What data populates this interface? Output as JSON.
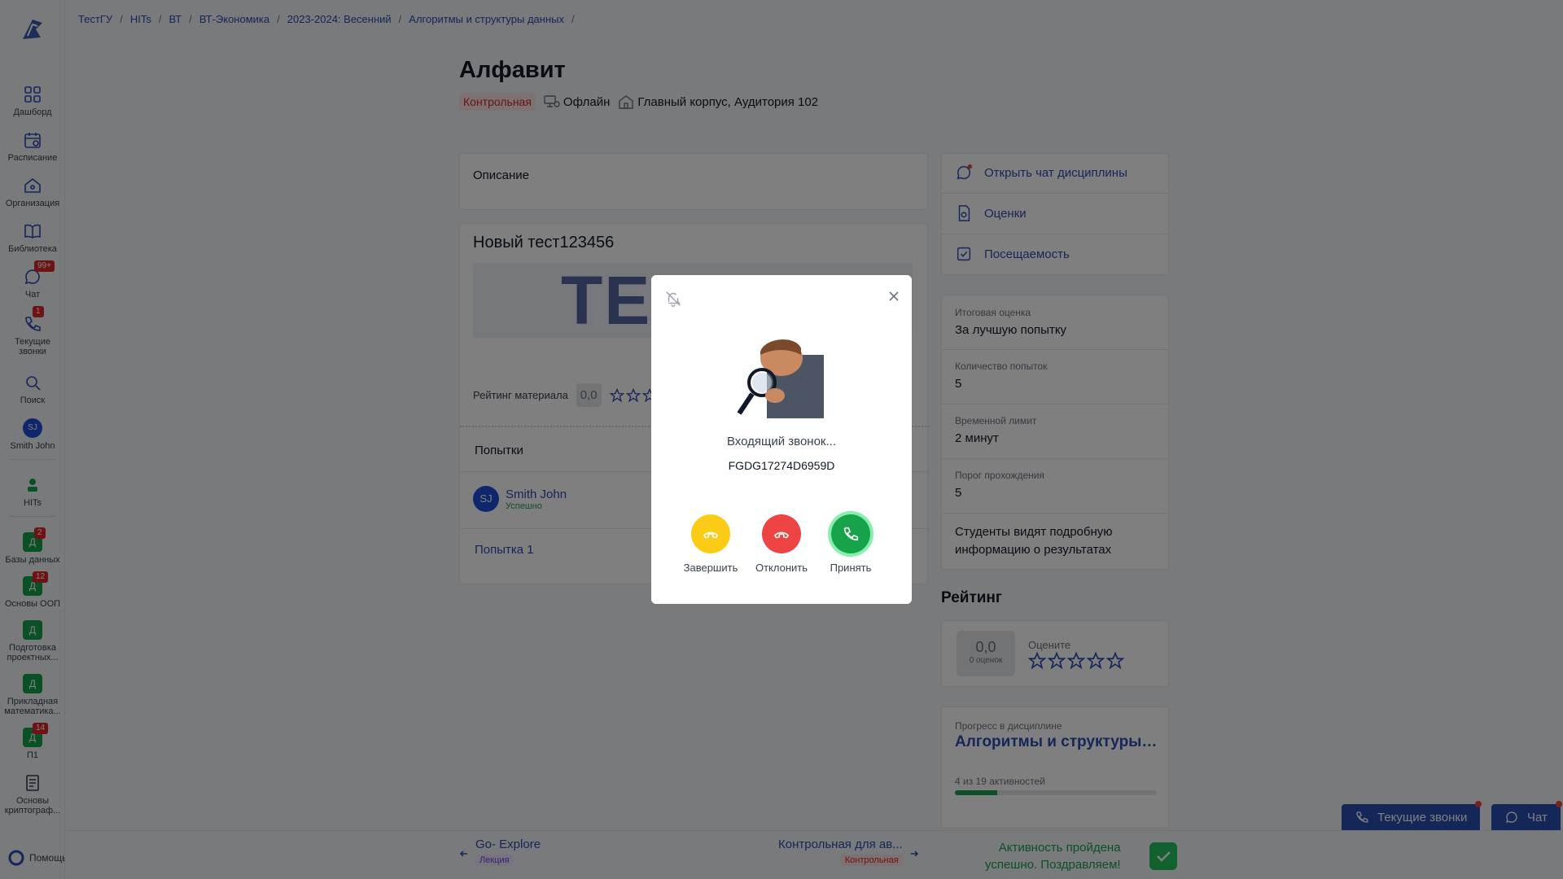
{
  "breadcrumb": [
    "ТестГУ",
    "HITs",
    "ВТ",
    "ВТ-Экономика",
    "2023-2024: Весенний",
    "Алгоритмы и структуры данных"
  ],
  "sidebar": {
    "items": [
      {
        "label": "Дашборд",
        "icon": "grid-icon"
      },
      {
        "label": "Расписание",
        "icon": "calendar-icon"
      },
      {
        "label": "Организация",
        "icon": "home-icon"
      },
      {
        "label": "Библиотека",
        "icon": "book-icon"
      },
      {
        "label": "Чат",
        "icon": "chat-icon",
        "badge": "99+"
      },
      {
        "label": "Текущие звонки",
        "icon": "phone-icon",
        "badge": "1"
      },
      {
        "label": "Поиск",
        "icon": "search-icon"
      },
      {
        "label": "Smith John",
        "avatar": "SJ"
      },
      {
        "label": "HITs",
        "icon": "org-logo-icon"
      }
    ],
    "courses": [
      {
        "letter": "Д",
        "label": "Базы данных",
        "badge": "2"
      },
      {
        "letter": "Д",
        "label": "Основы ООП",
        "badge": "12"
      },
      {
        "letter": "Д",
        "label": "Подготовка проектных..."
      },
      {
        "letter": "Д",
        "label": "Прикладная математика..."
      },
      {
        "letter": "Д",
        "label": "П1",
        "badge": "14"
      }
    ],
    "crypto": {
      "label": "Основы криптограф..."
    },
    "help": "Помощь"
  },
  "page": {
    "title": "Алфавит",
    "type_tag": "Контрольная",
    "mode": "Офлайн",
    "location": "Главный корпус, Аудитория 102"
  },
  "description": {
    "title": "Описание"
  },
  "test": {
    "title": "Новый тест123456",
    "banner_text": "ТЕС",
    "rating_label": "Рейтинг материала",
    "rating_value": "0,0",
    "attempts_title": "Попытки",
    "user_initials": "SJ",
    "user_name": "Smith John",
    "user_status": "Успешно",
    "attempt_link": "Попытка 1"
  },
  "actions": {
    "chat": "Открыть чат дисциплины",
    "grades": "Оценки",
    "attendance": "Посещаемость"
  },
  "info": {
    "final_grade_label": "Итоговая оценка",
    "final_grade_value": "За лучшую попытку",
    "attempts_label": "Количество попыток",
    "attempts_value": "5",
    "time_label": "Временной лимит",
    "time_value": "2 минут",
    "threshold_label": "Порог прохождения",
    "threshold_value": "5",
    "students_note": "Студенты видят подробную информацию о результатах"
  },
  "rating": {
    "title": "Рейтинг",
    "value": "0,0",
    "count": "0 оценок",
    "rate_label": "Оцените",
    "stars": 5
  },
  "progress": {
    "label": "Прогресс в дисциплине",
    "title": "Алгоритмы и структуры данных",
    "count_text": "4 из 19 активностей",
    "fraction": 0.21
  },
  "bottom": {
    "prev_title": "Go- Explore",
    "prev_tag": "Лекция",
    "next_title": "Контрольная для ав...",
    "next_tag": "Контрольная",
    "done_line1": "Активность пройдена",
    "done_line2": "успешно. Поздравляем!"
  },
  "floating": {
    "calls": "Текущие звонки",
    "chat": "Чат"
  },
  "call": {
    "incoming": "Входящий звонок...",
    "caller_id": "FGDG17274D6959D",
    "end": "Завершить",
    "decline": "Отклонить",
    "accept": "Принять"
  },
  "colors": {
    "accent": "#2a4db3",
    "success": "#16a34a",
    "danger": "#ef4444",
    "warning": "#facc15",
    "overlay": "rgba(0,0,0,0.5)"
  }
}
